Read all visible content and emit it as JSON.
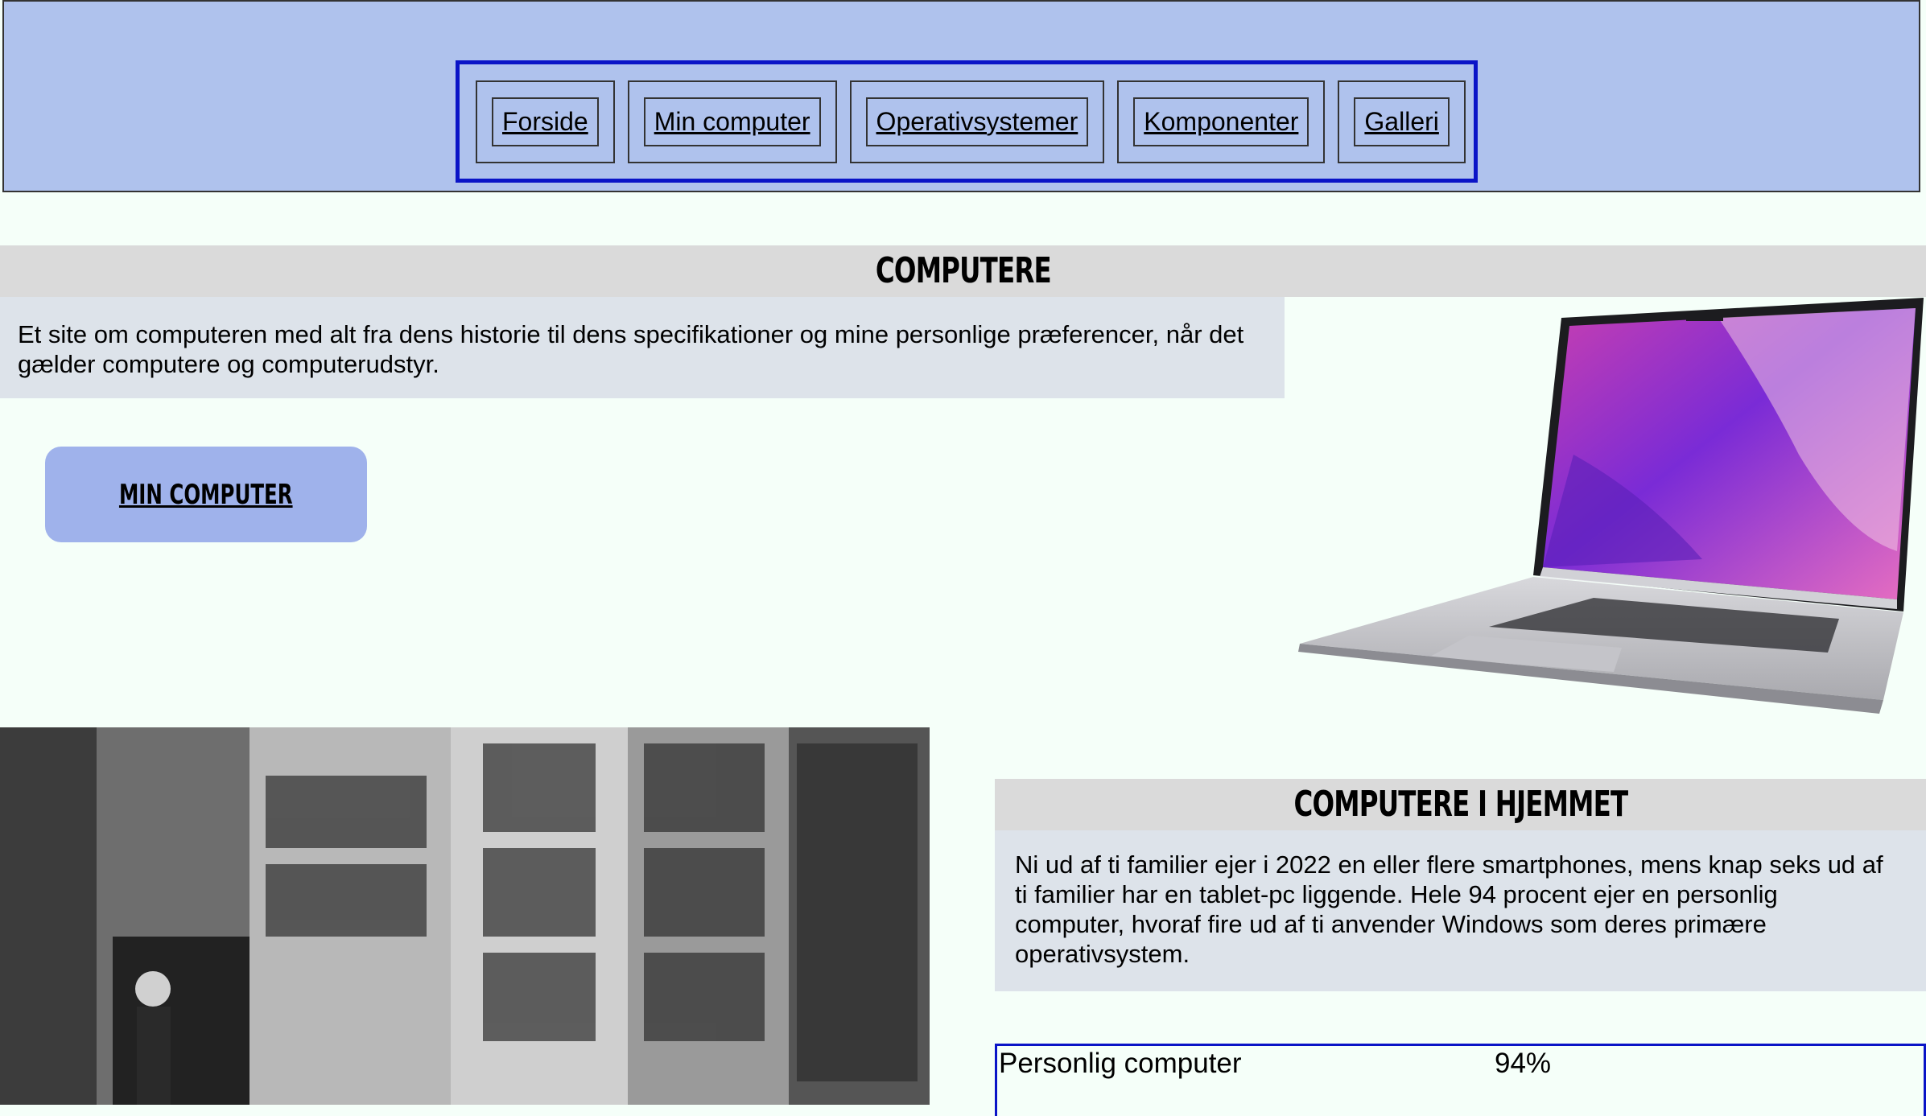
{
  "nav": {
    "items": [
      {
        "label": "Forside"
      },
      {
        "label": "Min computer"
      },
      {
        "label": "Operativsystemer"
      },
      {
        "label": "Komponenter"
      },
      {
        "label": "Galleri"
      }
    ]
  },
  "hero": {
    "title": "COMPUTERE",
    "intro": "Et site om computeren med alt fra dens historie til dens specifikationer og mine personlige præferencer, når det gælder computere og computerudstyr.",
    "button_label": "MIN COMPUTER"
  },
  "home_section": {
    "title": "COMPUTERE I HJEMMET",
    "text": "Ni ud af ti familier ejer i 2022 en eller flere smartphones, mens knap seks ud af ti familier har en tablet-pc liggende. Hele 94 procent ejer en personlig computer, hvoraf fire ud af ti anvender Windows som deres primære operativsystem."
  },
  "stats": [
    {
      "label": "Personlig computer",
      "value": "94%"
    }
  ],
  "colors": {
    "header_bg": "#afc2ed",
    "nav_border": "#0a14c7",
    "button_bg": "#9fb2eb",
    "page_bg": "#f5fff9"
  }
}
